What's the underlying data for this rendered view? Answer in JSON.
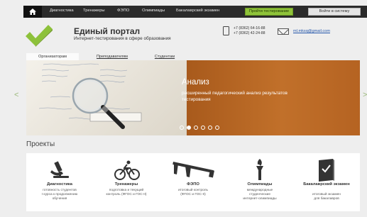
{
  "nav": {
    "items": [
      "Диагностика",
      "Тренажеры",
      "ФЭПО",
      "Олимпиады",
      "Бакалаврский экзамен"
    ],
    "start_test": "Пройти тестирование",
    "login": "Войти в систему"
  },
  "header": {
    "title": "Единый портал",
    "subtitle": "Интернет-тестирования в сфере образования",
    "phone1": "+7 (8362) 64-16-88",
    "phone2": "+7 (8362) 42-24-88",
    "email": "ml.mksq@gmail.com"
  },
  "tabs": [
    "Организаторам",
    "Преподавателям",
    "Студентам"
  ],
  "slider": {
    "title": "Анализ",
    "text_line1": "расширенный педагогический анализ результатов",
    "text_line2": "тестирования",
    "dots_total": 6,
    "active_dot": 1
  },
  "projects": {
    "heading": "Проекты",
    "items": [
      {
        "title": "Диагностика",
        "desc": [
          "готовность студентов",
          "I курса к продолжению",
          "обучения"
        ],
        "icon": "microscope-icon"
      },
      {
        "title": "Тренажеры",
        "desc": [
          "подготовка и текущий",
          "контроль (ФГОС и ГОС-II)"
        ],
        "icon": "cyclist-icon"
      },
      {
        "title": "ФЭПО",
        "desc": [
          "итоговый контроль",
          "(ФГОС и ГОС-II)"
        ],
        "icon": "caliper-icon"
      },
      {
        "title": "Олимпиады",
        "desc": [
          "международные",
          "студенческие",
          "интернет-олимпиады"
        ],
        "icon": "torch-icon"
      },
      {
        "title": "Бакалаврский экзамен",
        "desc": [
          "итоговый экзамен",
          "для бакалавров"
        ],
        "icon": "book-icon"
      }
    ]
  },
  "colors": {
    "accent": "#8fc33a",
    "nav_bg": "#2b2b2b",
    "slide_bg": "#b8682a"
  }
}
